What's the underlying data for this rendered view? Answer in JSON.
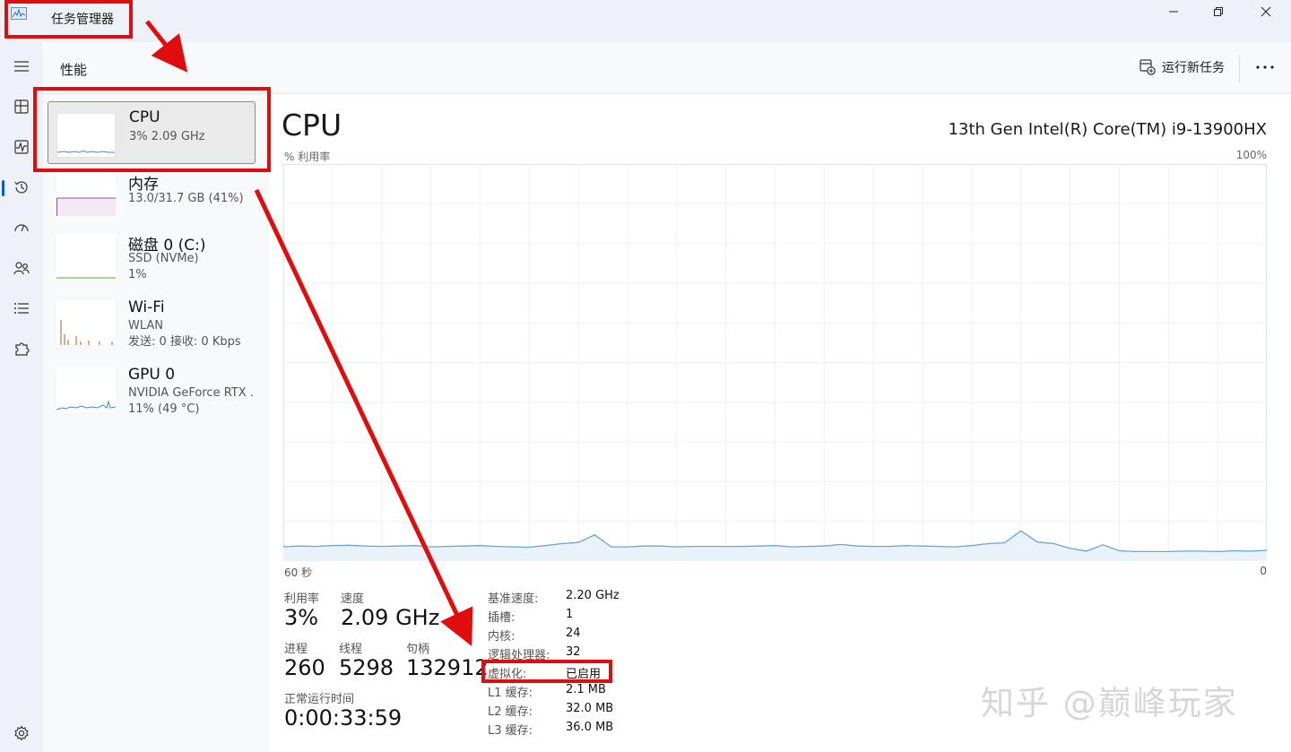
{
  "titlebar": {
    "app_title": "任务管理器"
  },
  "header": {
    "page_title": "性能",
    "run_new_task": "运行新任务"
  },
  "sidebar": {
    "items": [
      {
        "name": "CPU",
        "sub1": "3% 2.09 GHz",
        "sub2": ""
      },
      {
        "name": "内存",
        "sub1": "13.0/31.7 GB (41%)",
        "sub2": ""
      },
      {
        "name": "磁盘 0 (C:)",
        "sub1": "SSD (NVMe)",
        "sub2": "1%"
      },
      {
        "name": "Wi-Fi",
        "sub1": "WLAN",
        "sub2": "发送: 0 接收: 0 Kbps"
      },
      {
        "name": "GPU 0",
        "sub1": "NVIDIA GeForce RTX .",
        "sub2": "11% (49 °C)"
      }
    ]
  },
  "main": {
    "heading": "CPU",
    "model": "13th Gen Intel(R) Core(TM) i9-13900HX",
    "axis_left": "% 利用率",
    "axis_right": "100%",
    "x_left": "60 秒",
    "x_right": "0",
    "stats": {
      "util_label": "利用率",
      "util_value": "3%",
      "speed_label": "速度",
      "speed_value": "2.09 GHz",
      "proc_label": "进程",
      "proc_value": "260",
      "thread_label": "线程",
      "thread_value": "5298",
      "handle_label": "句柄",
      "handle_value": "132912",
      "uptime_label": "正常运行时间",
      "uptime_value": "0:00:33:59"
    },
    "details": [
      {
        "k": "基准速度:",
        "v": "2.20 GHz"
      },
      {
        "k": "插槽:",
        "v": "1"
      },
      {
        "k": "内核:",
        "v": "24"
      },
      {
        "k": "逻辑处理器:",
        "v": "32"
      },
      {
        "k": "虚拟化:",
        "v": "已启用"
      },
      {
        "k": "L1 缓存:",
        "v": "2.1 MB"
      },
      {
        "k": "L2 缓存:",
        "v": "32.0 MB"
      },
      {
        "k": "L3 缓存:",
        "v": "36.0 MB"
      }
    ],
    "cpu_history_percent": [
      3.6,
      3.8,
      3.7,
      3.9,
      4.0,
      3.8,
      3.7,
      3.8,
      3.9,
      3.6,
      3.7,
      3.8,
      3.9,
      3.7,
      3.6,
      3.5,
      3.9,
      4.4,
      4.7,
      6.6,
      3.6,
      3.6,
      3.8,
      3.8,
      3.6,
      3.7,
      3.7,
      3.7,
      3.7,
      3.8,
      3.9,
      3.6,
      3.7,
      3.8,
      4.2,
      3.8,
      3.7,
      3.7,
      3.9,
      3.8,
      3.7,
      3.6,
      3.9,
      4.4,
      4.6,
      7.6,
      4.8,
      4.4,
      3.2,
      2.5,
      4.1,
      2.6,
      2.4,
      2.4,
      2.4,
      2.5,
      2.5,
      2.4,
      2.6,
      2.5,
      2.7
    ]
  },
  "colors": {
    "cpu_line": "#6aa5d4",
    "cpu_fill": "#eaf2f9",
    "memory_line": "#9b4c9e",
    "disk_line": "#5aa52f",
    "wifi_bar": "#c48a5c",
    "highlight": "#e10d0d",
    "accent": "#005fb8"
  },
  "watermark": "知乎 @巅峰玩家"
}
